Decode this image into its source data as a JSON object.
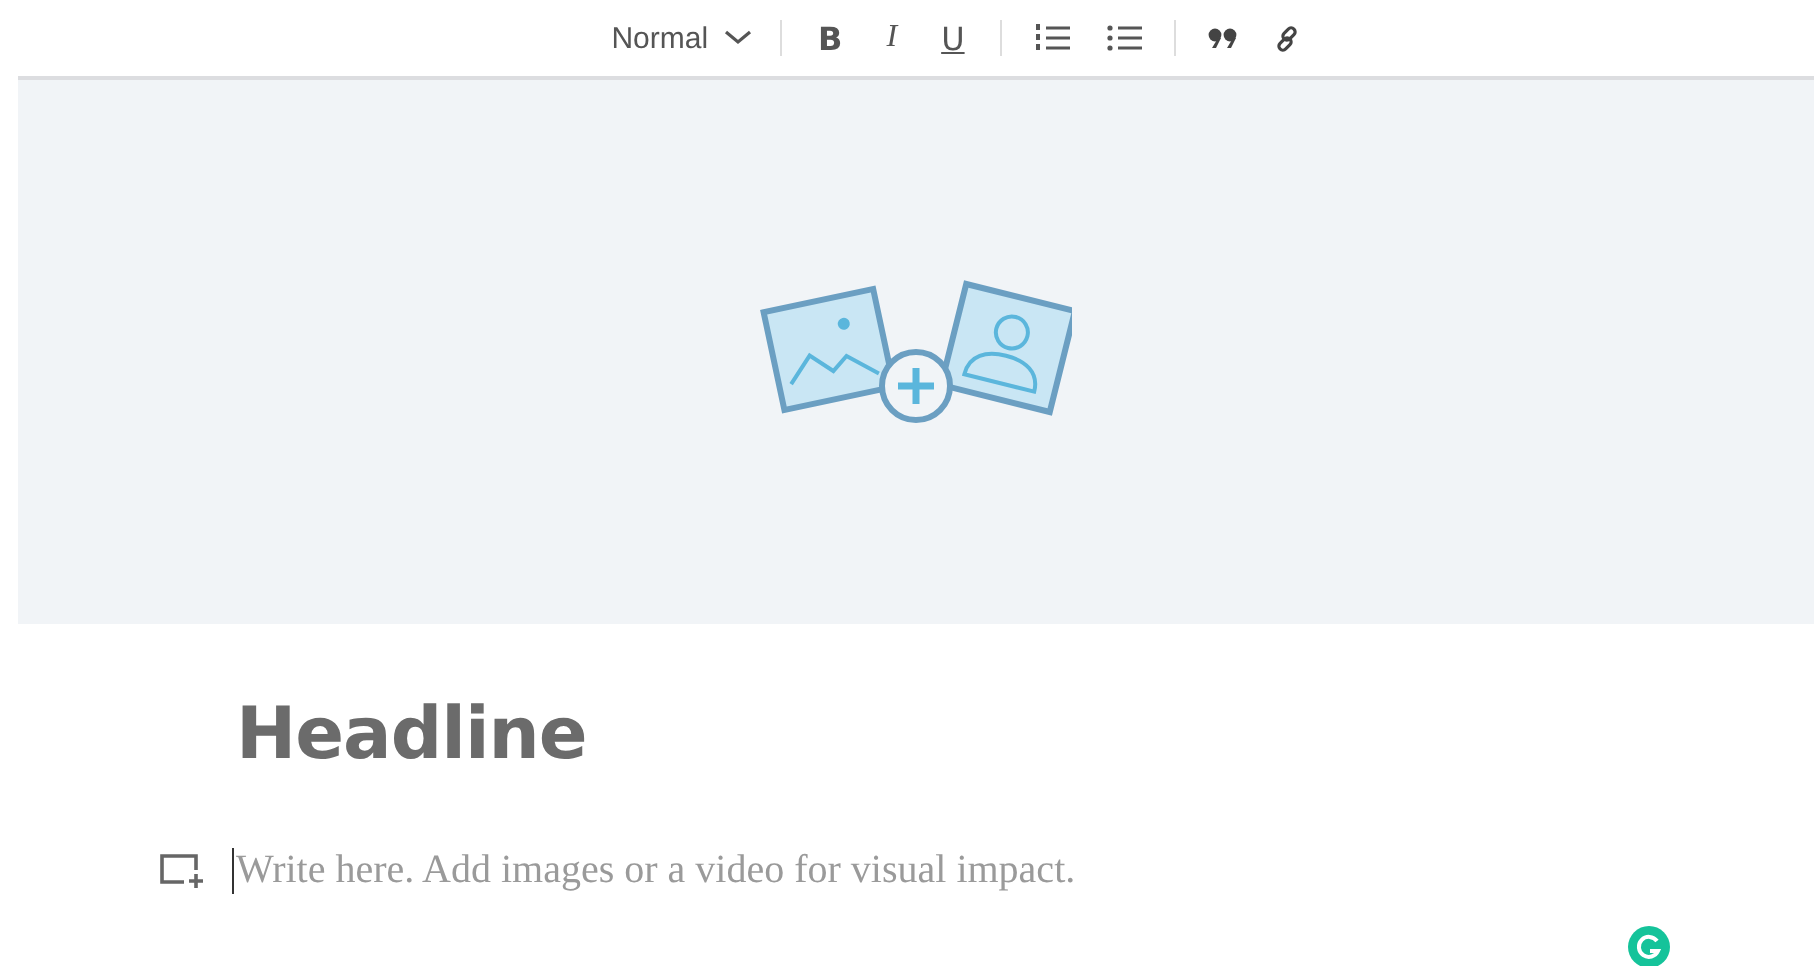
{
  "toolbar": {
    "block_style": "Normal",
    "format_buttons": [
      {
        "label": "B",
        "kind": "bold"
      },
      {
        "label": "I",
        "kind": "italic"
      },
      {
        "label": "U",
        "kind": "underline"
      }
    ]
  },
  "headline": "Headline",
  "body": {
    "placeholder": "Write here. Add images or a video for visual impact."
  }
}
